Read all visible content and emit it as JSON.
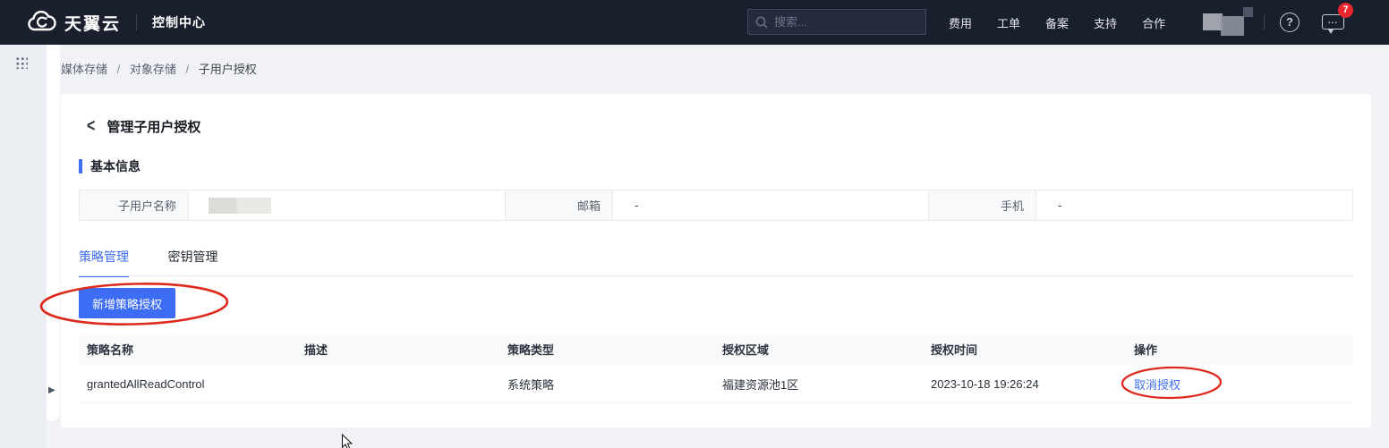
{
  "header": {
    "logo_text": "天翼云",
    "console_label": "控制中心",
    "search_placeholder": "搜索...",
    "nav_items": [
      "费用",
      "工单",
      "备案",
      "支持",
      "合作"
    ],
    "notification_count": "7",
    "help_glyph": "?",
    "message_glyph": "..."
  },
  "breadcrumb": {
    "items": [
      "媒体存储",
      "对象存储",
      "子用户授权"
    ],
    "separator": "/"
  },
  "page": {
    "back_glyph": "<",
    "title": "管理子用户授权",
    "section_title": "基本信息",
    "expand_glyph": "▶"
  },
  "basic_info": {
    "fields": [
      {
        "label": "子用户名称",
        "value": "",
        "redacted": true
      },
      {
        "label": "邮箱",
        "value": "-",
        "redacted": false
      },
      {
        "label": "手机",
        "value": "-",
        "redacted": false
      }
    ]
  },
  "tabs": [
    {
      "label": "策略管理",
      "active": true
    },
    {
      "label": "密钥管理",
      "active": false
    }
  ],
  "toolbar": {
    "add_policy_button": "新增策略授权"
  },
  "policy_table": {
    "columns": [
      "策略名称",
      "描述",
      "策略类型",
      "授权区域",
      "授权时间",
      "操作"
    ],
    "rows": [
      {
        "name": "grantedAllReadControl",
        "description": "",
        "type": "系统策略",
        "region": "福建资源池1区",
        "time": "2023-10-18 19:26:24",
        "action": "取消授权"
      }
    ]
  },
  "colors": {
    "header_bg": "#1a1f2d",
    "accent_blue": "#3d6df5",
    "annotation_red": "#de291d",
    "badge_red": "#e8252a",
    "page_bg": "#f0f2f5"
  }
}
